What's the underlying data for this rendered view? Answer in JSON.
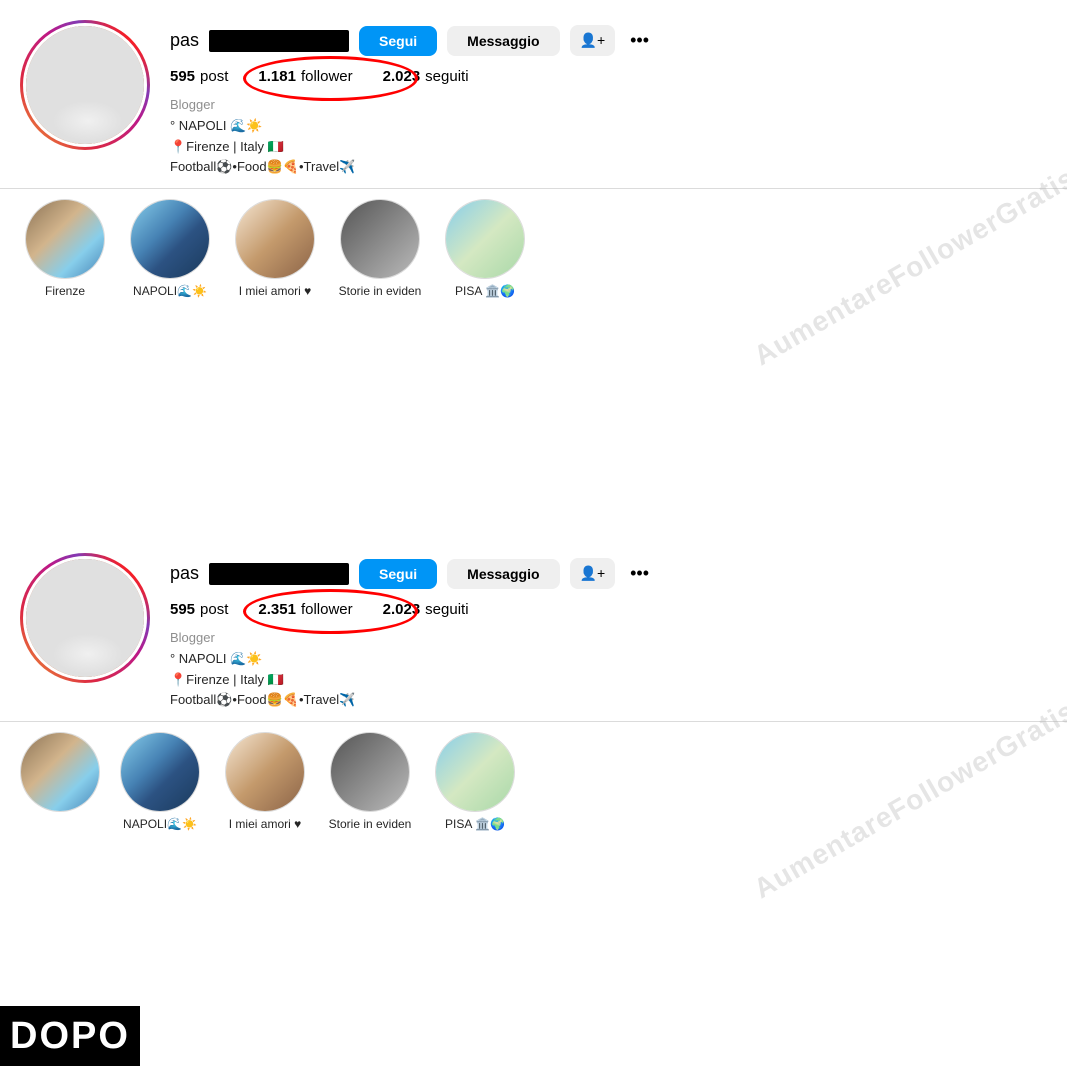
{
  "panels": [
    {
      "id": "prima",
      "label": null,
      "username_prefix": "pas",
      "stats": {
        "posts_label": "post",
        "posts_count": "595",
        "followers_count": "1.181",
        "followers_label": "follower",
        "seguiti_count": "2.023",
        "seguiti_label": "seguiti"
      },
      "buttons": {
        "segui": "Segui",
        "messaggio": "Messaggio",
        "add_icon": "⊕",
        "more": "•••"
      },
      "bio": {
        "role": "Blogger",
        "line1": "° NAPOLI 🌊☀️",
        "line2": "📍Firenze | Italy 🇮🇹",
        "line3": "Football⚽•Food🍔🍕•Travel✈️"
      },
      "stories": [
        {
          "label": "Firenze",
          "thumb": "city"
        },
        {
          "label": "NAPOLI🌊☀️",
          "thumb": "napoli"
        },
        {
          "label": "I miei amori ♥",
          "thumb": "family"
        },
        {
          "label": "Storie in eviden",
          "thumb": "street"
        },
        {
          "label": "PISA 🏛️🌍",
          "thumb": "pisa"
        }
      ],
      "watermark": "AumentareFollowerGratis"
    },
    {
      "id": "dopo",
      "label": "DOPO",
      "username_prefix": "pas",
      "stats": {
        "posts_label": "post",
        "posts_count": "595",
        "followers_count": "2.351",
        "followers_label": "follower",
        "seguiti_count": "2.023",
        "seguiti_label": "seguiti"
      },
      "buttons": {
        "segui": "Segui",
        "messaggio": "Messaggio",
        "add_icon": "⊕",
        "more": "•••"
      },
      "bio": {
        "role": "Blogger",
        "line1": "° NAPOLI 🌊☀️",
        "line2": "📍Firenze | Italy 🇮🇹",
        "line3": "Football⚽•Food🍔🍕•Travel✈️"
      },
      "stories": [
        {
          "label": "NAPOLI🌊☀️",
          "thumb": "napoli"
        },
        {
          "label": "I miei amori ♥",
          "thumb": "family"
        },
        {
          "label": "Storie in eviden",
          "thumb": "street"
        },
        {
          "label": "PISA 🏛️🌍",
          "thumb": "pisa"
        }
      ],
      "watermark": "AumentareFollowerGratis"
    }
  ]
}
